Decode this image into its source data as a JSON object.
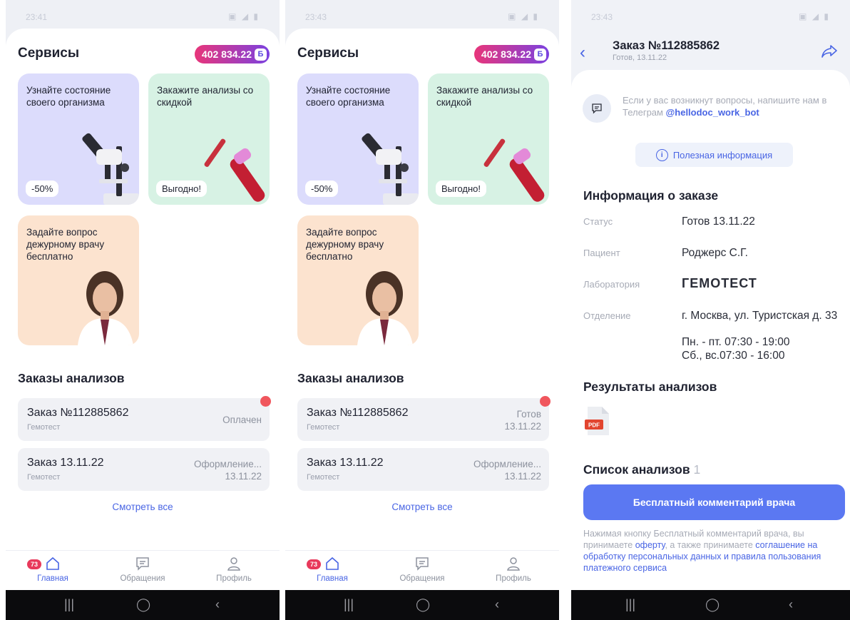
{
  "status_bars": [
    "23:41",
    "23:43",
    "23:43"
  ],
  "services": {
    "title": "Сервисы",
    "balance": "402 834.22",
    "balance_icon_letter": "Б",
    "cards": [
      {
        "text": "Узнайте состояние своего организма",
        "tag": "-50%",
        "icon": "microscope-illustration"
      },
      {
        "text": "Закажите анализы со скидкой",
        "tag": "Выгодно!",
        "icon": "test-tube-illustration"
      },
      {
        "text": "Задайте вопрос дежурному врачу бесплатно",
        "icon": "doctor-photo"
      }
    ]
  },
  "orders": {
    "title": "Заказы анализов",
    "screen1": [
      {
        "name": "Заказ №112885862",
        "lab": "Гемотест",
        "status": "Оплачен",
        "status2": "",
        "unread": true
      },
      {
        "name": "Заказ 13.11.22",
        "lab": "Гемотест",
        "status": "Оформление...",
        "status2": "13.11.22",
        "unread": false
      }
    ],
    "screen2": [
      {
        "name": "Заказ №112885862",
        "lab": "Гемотест",
        "status": "Готов",
        "status2": "13.11.22",
        "unread": true
      },
      {
        "name": "Заказ 13.11.22",
        "lab": "Гемотест",
        "status": "Оформление...",
        "status2": "13.11.22",
        "unread": false
      }
    ],
    "see_all": "Смотреть все"
  },
  "tabbar": {
    "home": "Главная",
    "home_badge": "73",
    "appeals": "Обращения",
    "profile": "Профиль"
  },
  "order_detail": {
    "title": "Заказ №112885862",
    "subtitle": "Готов, 13.11.22",
    "help_text": "Если у вас возникнут вопросы, напишите нам в Телеграм",
    "telegram": "@hellodoc_work_bot",
    "useful_info": "Полезная информация",
    "info_title": "Информация о заказе",
    "rows": [
      {
        "key": "Статус",
        "value": "Готов 13.11.22"
      },
      {
        "key": "Пациент",
        "value": "Роджерс С.Г."
      },
      {
        "key": "Лаборатория",
        "value": "ГЕМОТЕСТ"
      },
      {
        "key": "Отделение",
        "value": "г. Москва, ул. Туристская д. 33"
      }
    ],
    "hours_1": "Пн. - пт. 07:30 - 19:00",
    "hours_2": "Сб., вс.07:30 - 16:00",
    "results_title": "Результаты анализов",
    "pdf_label": "PDF",
    "list_title": "Список анализов",
    "list_count": "1",
    "doctor_button": "Бесплатный комментарий врача",
    "consent_1": "Нажимая кнопку Бесплатный комментарий врача, вы принимаете",
    "consent_link_1": "оферту",
    "consent_2": ", а также принимаете",
    "consent_link_2": "соглашение на обработку персональных данных и правила пользования платежного сервиса"
  },
  "colors": {
    "accent": "#4965e4",
    "lab_green": "#2aa54a",
    "unread_dot": "#f0565d",
    "button": "#5b78f2"
  }
}
